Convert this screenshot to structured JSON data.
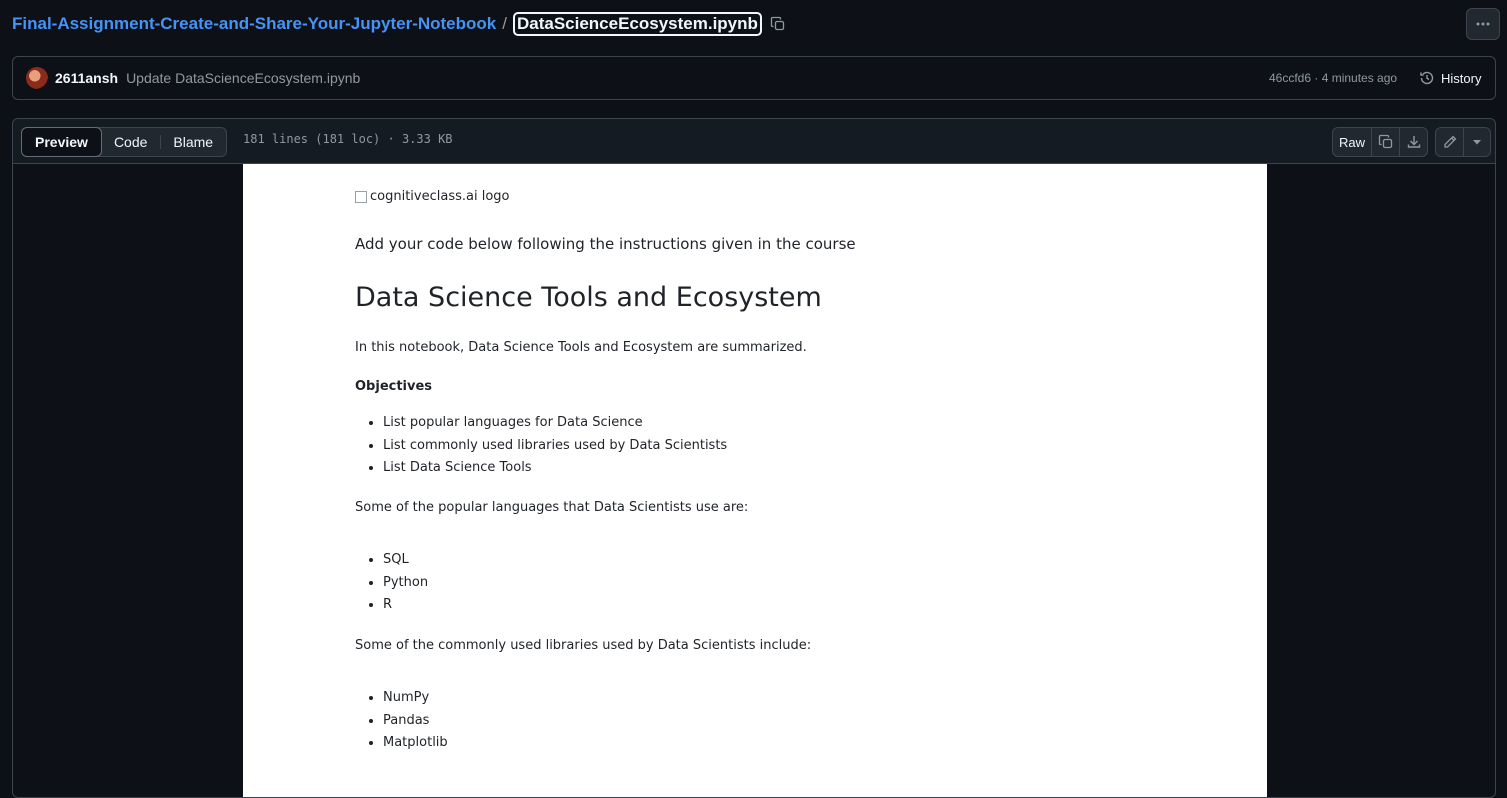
{
  "breadcrumb": {
    "repo": "Final-Assignment-Create-and-Share-Your-Jupyter-Notebook",
    "separator": "/",
    "file": "DataScienceEcosystem.ipynb"
  },
  "commit": {
    "author": "2611ansh",
    "message": "Update DataScienceEcosystem.ipynb",
    "meta": "46ccfd6 · 4 minutes ago",
    "history_label": "History"
  },
  "file_header": {
    "tabs": [
      {
        "label": "Preview",
        "active": true
      },
      {
        "label": "Code",
        "active": false
      },
      {
        "label": "Blame",
        "active": false
      }
    ],
    "info": "181 lines (181 loc) · 3.33 KB",
    "raw_label": "Raw"
  },
  "notebook": {
    "logo_alt": "cognitiveclass.ai logo",
    "intro": "Add your code below following the instructions given in the course",
    "title": "Data Science Tools and Ecosystem",
    "summary": "In this notebook, Data Science Tools and Ecosystem are summarized.",
    "objectives_heading": "Objectives",
    "objectives": [
      "List popular languages for Data Science",
      "List commonly used libraries used by Data Scientists",
      "List Data Science Tools"
    ],
    "languages_intro": "Some of the popular languages that Data Scientists use are:",
    "languages": [
      "SQL",
      "Python",
      "R"
    ],
    "libraries_intro": "Some of the commonly used libraries used by Data Scientists include:",
    "libraries": [
      "NumPy",
      "Pandas",
      "Matplotlib"
    ]
  },
  "icons": {
    "copy": "copy-icon",
    "more": "kebab-horizontal-icon",
    "history": "history-icon",
    "download": "download-icon",
    "edit": "pencil-icon",
    "dropdown": "triangle-down-icon"
  },
  "colors": {
    "link": "#4493f8",
    "background": "#0d1117",
    "border": "#3d444d"
  }
}
